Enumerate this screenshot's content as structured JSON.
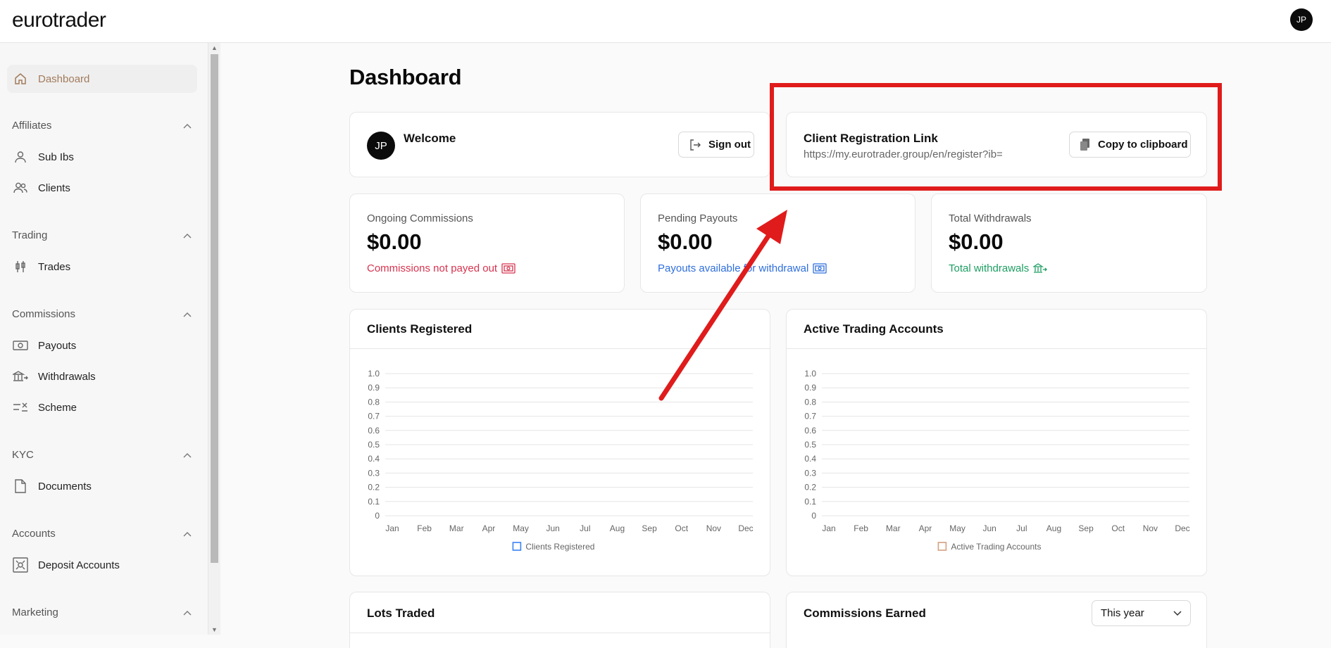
{
  "app": {
    "logo": "eurotrader",
    "avatar_initials": "JP"
  },
  "sidebar": {
    "dashboard": "Dashboard",
    "sections": [
      {
        "title": "Affiliates",
        "items": [
          "Sub Ibs",
          "Clients"
        ]
      },
      {
        "title": "Trading",
        "items": [
          "Trades"
        ]
      },
      {
        "title": "Commissions",
        "items": [
          "Payouts",
          "Withdrawals",
          "Scheme"
        ]
      },
      {
        "title": "KYC",
        "items": [
          "Documents"
        ]
      },
      {
        "title": "Accounts",
        "items": [
          "Deposit Accounts"
        ]
      },
      {
        "title": "Marketing",
        "items": []
      }
    ]
  },
  "main": {
    "title": "Dashboard",
    "welcome": {
      "avatar": "JP",
      "text": "Welcome",
      "sign_out": "Sign out"
    },
    "registration": {
      "title": "Client Registration Link",
      "url": "https://my.eurotrader.group/en/register?ib=",
      "copy_button": "Copy to clipboard"
    },
    "stats": [
      {
        "label": "Ongoing Commissions",
        "value": "$0.00",
        "note": "Commissions not payed out",
        "color": "#d6334f"
      },
      {
        "label": "Pending Payouts",
        "value": "$0.00",
        "note": "Payouts available for withdrawal",
        "color": "#2f6fdc"
      },
      {
        "label": "Total Withdrawals",
        "value": "$0.00",
        "note": "Total withdrawals",
        "color": "#1e9e62"
      }
    ],
    "lots_traded": {
      "title": "Lots Traded"
    },
    "commissions_earned": {
      "title": "Commissions Earned",
      "period_select": "This year"
    }
  },
  "chart_data": [
    {
      "type": "line",
      "title": "Clients Registered",
      "categories": [
        "Jan",
        "Feb",
        "Mar",
        "Apr",
        "May",
        "Jun",
        "Jul",
        "Aug",
        "Sep",
        "Oct",
        "Nov",
        "Dec"
      ],
      "series": [
        {
          "name": "Clients Registered",
          "values": [],
          "color": "#3b82f6"
        }
      ],
      "yticks": [
        "0",
        "0.1",
        "0.2",
        "0.3",
        "0.4",
        "0.5",
        "0.6",
        "0.7",
        "0.8",
        "0.9",
        "1.0"
      ],
      "ylim": [
        0,
        1
      ],
      "legend": "bottom"
    },
    {
      "type": "line",
      "title": "Active Trading Accounts",
      "categories": [
        "Jan",
        "Feb",
        "Mar",
        "Apr",
        "May",
        "Jun",
        "Jul",
        "Aug",
        "Sep",
        "Oct",
        "Nov",
        "Dec"
      ],
      "series": [
        {
          "name": "Active Trading Accounts",
          "values": [],
          "color": "#d6a07e"
        }
      ],
      "yticks": [
        "0",
        "0.1",
        "0.2",
        "0.3",
        "0.4",
        "0.5",
        "0.6",
        "0.7",
        "0.8",
        "0.9",
        "1.0"
      ],
      "ylim": [
        0,
        1
      ],
      "legend": "bottom"
    }
  ]
}
